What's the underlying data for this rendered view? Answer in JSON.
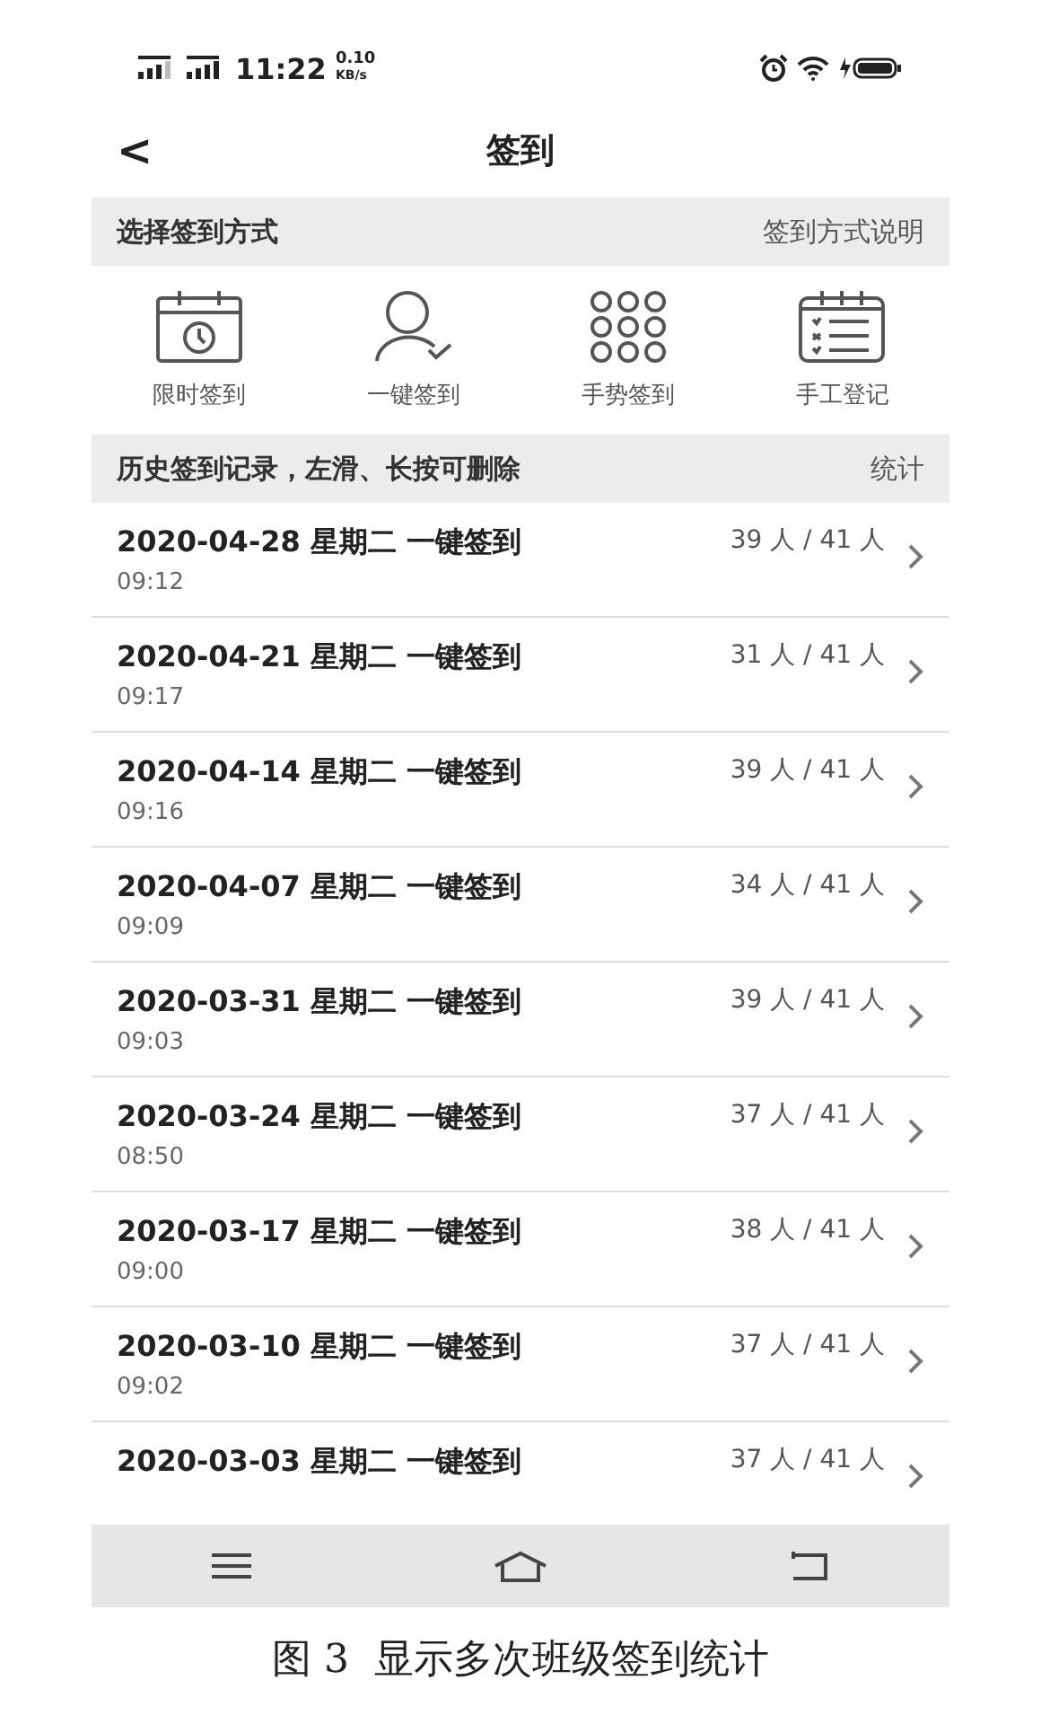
{
  "status_bar": {
    "time": "11:22",
    "speed_value": "0.10",
    "speed_unit": "KB/s"
  },
  "header": {
    "back": "<",
    "title": "签到"
  },
  "methods_section": {
    "title": "选择签到方式",
    "link": "签到方式说明"
  },
  "methods": [
    {
      "kind": "timer",
      "label": "限时签到"
    },
    {
      "kind": "person",
      "label": "一键签到"
    },
    {
      "kind": "gesture",
      "label": "手势签到"
    },
    {
      "kind": "checklist",
      "label": "手工登记"
    }
  ],
  "history_section": {
    "title": "历史签到记录，左滑、长按可删除",
    "link": "统计"
  },
  "records": [
    {
      "title": "2020-04-28 星期二 一键签到",
      "time": "09:12",
      "count": "39 人 / 41 人"
    },
    {
      "title": "2020-04-21 星期二 一键签到",
      "time": "09:17",
      "count": "31 人 / 41 人"
    },
    {
      "title": "2020-04-14 星期二 一键签到",
      "time": "09:16",
      "count": "39 人 / 41 人"
    },
    {
      "title": "2020-04-07 星期二 一键签到",
      "time": "09:09",
      "count": "34 人 / 41 人"
    },
    {
      "title": "2020-03-31 星期二 一键签到",
      "time": "09:03",
      "count": "39 人 / 41 人"
    },
    {
      "title": "2020-03-24 星期二 一键签到",
      "time": "08:50",
      "count": "37 人 / 41 人"
    },
    {
      "title": "2020-03-17 星期二 一键签到",
      "time": "09:00",
      "count": "38 人 / 41 人"
    },
    {
      "title": "2020-03-10 星期二 一键签到",
      "time": "09:02",
      "count": "37 人 / 41 人"
    },
    {
      "title": "2020-03-03 星期二 一键签到",
      "count": "37 人 / 41 人"
    }
  ],
  "caption": "图 3  显示多次班级签到统计"
}
